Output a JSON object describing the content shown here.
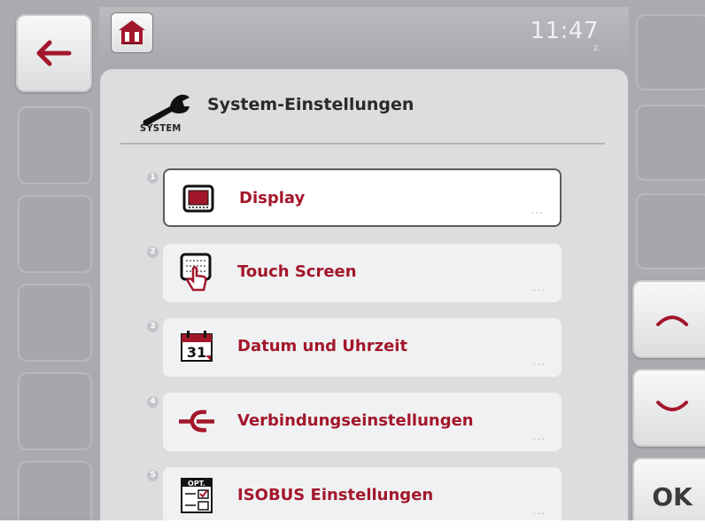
{
  "header": {
    "time": "11:47",
    "sub": "2."
  },
  "page": {
    "icon_label": "SYSTEM",
    "title": "System-Einstellungen"
  },
  "menu": [
    {
      "index": "1",
      "label": "Display",
      "more": "...",
      "icon": "display-icon",
      "selected": true
    },
    {
      "index": "2",
      "label": "Touch Screen",
      "more": "...",
      "icon": "touch-screen-icon",
      "selected": false
    },
    {
      "index": "3",
      "label": "Datum und Uhrzeit",
      "more": "...",
      "icon": "calendar-icon",
      "selected": false
    },
    {
      "index": "4",
      "label": "Verbindungseinstellungen",
      "more": "...",
      "icon": "connector-icon",
      "selected": false
    },
    {
      "index": "5",
      "label": "ISOBUS Einstellungen",
      "more": "...",
      "icon": "options-icon",
      "selected": false
    }
  ],
  "softkeys": {
    "back": "back-arrow-icon",
    "up": "chevron-up-icon",
    "down": "chevron-down-icon",
    "ok_label": "OK"
  },
  "colors": {
    "accent": "#a3172b",
    "background": "#a9abae",
    "panel": "#dcdddf"
  }
}
